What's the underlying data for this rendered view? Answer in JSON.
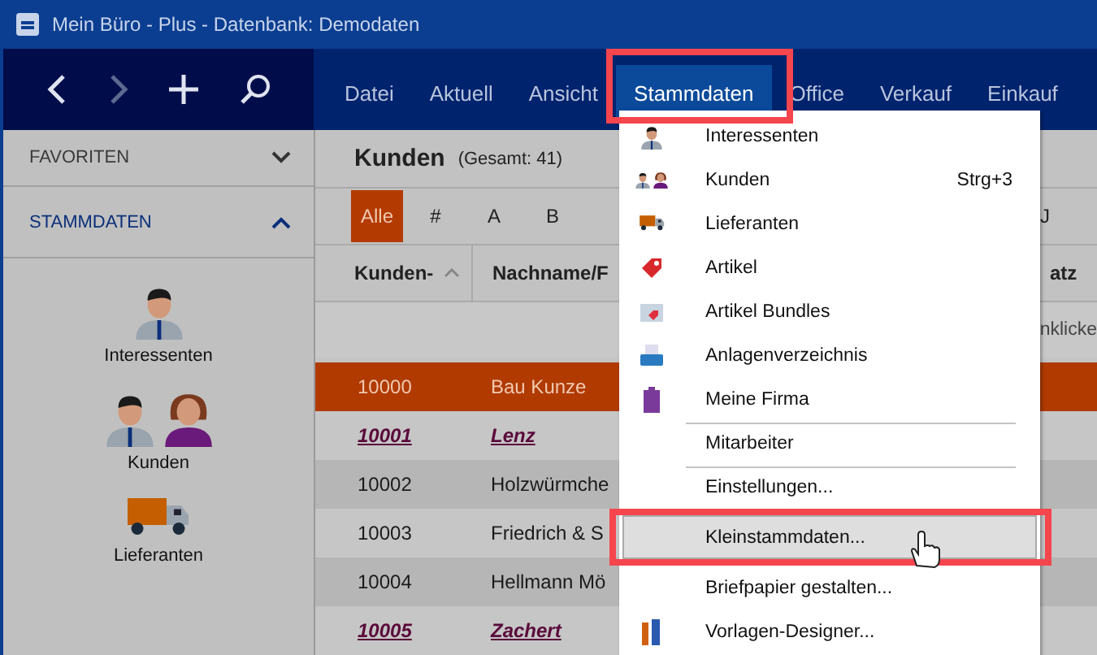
{
  "window": {
    "title": "Mein Büro - Plus - Datenbank: Demodaten"
  },
  "menubar": [
    {
      "label": "Datei",
      "selected": false
    },
    {
      "label": "Aktuell",
      "selected": false
    },
    {
      "label": "Ansicht",
      "selected": false
    },
    {
      "label": "Stammdaten",
      "selected": true
    },
    {
      "label": "Office",
      "selected": false
    },
    {
      "label": "Verkauf",
      "selected": false
    },
    {
      "label": "Einkauf",
      "selected": false
    }
  ],
  "sidebar": {
    "sections": [
      {
        "label": "FAVORITEN",
        "expanded": false
      },
      {
        "label": "STAMMDATEN",
        "expanded": true
      }
    ],
    "items": [
      {
        "label": "Interessenten"
      },
      {
        "label": "Kunden"
      },
      {
        "label": "Lieferanten"
      }
    ]
  },
  "content": {
    "title": "Kunden",
    "count": "(Gesamt: 41)",
    "letters": [
      {
        "label": "Alle",
        "selected": true
      },
      {
        "label": "#",
        "selected": false
      },
      {
        "label": "A",
        "selected": false
      },
      {
        "label": "B",
        "selected": false
      },
      {
        "label": "J",
        "selected": false
      }
    ],
    "filter_hint": "nklicke",
    "table": {
      "columns": [
        "Kunden-",
        "Nachname/F",
        "atz"
      ],
      "rows": [
        {
          "cells": [
            "10000",
            "Bau Kunze"
          ],
          "selected": true,
          "emphasized": false
        },
        {
          "cells": [
            "10001",
            "Lenz"
          ],
          "selected": false,
          "emphasized": true
        },
        {
          "cells": [
            "10002",
            "Holzwürmche"
          ],
          "selected": false,
          "emphasized": false
        },
        {
          "cells": [
            "10003",
            "Friedrich & S"
          ],
          "selected": false,
          "emphasized": false
        },
        {
          "cells": [
            "10004",
            "Hellmann Mö"
          ],
          "selected": false,
          "emphasized": false
        },
        {
          "cells": [
            "10005",
            "Zachert"
          ],
          "selected": false,
          "emphasized": true
        }
      ]
    }
  },
  "dropdown_menu": {
    "items": [
      {
        "label": "Interessenten",
        "selected": false,
        "separator_before": false
      },
      {
        "label": "Kunden",
        "shortcut": "Strg+3",
        "selected": false,
        "separator_before": false
      },
      {
        "label": "Lieferanten",
        "selected": false,
        "separator_before": false
      },
      {
        "label": "Artikel",
        "selected": false,
        "separator_before": false
      },
      {
        "label": "Artikel Bundles",
        "selected": false,
        "separator_before": false
      },
      {
        "label": "Anlagenverzeichnis",
        "selected": false,
        "separator_before": false
      },
      {
        "label": "Meine Firma",
        "selected": false,
        "separator_before": false
      },
      {
        "label": "Mitarbeiter",
        "selected": false,
        "separator_before": true
      },
      {
        "label": "Einstellungen...",
        "selected": false,
        "separator_before": true
      },
      {
        "label": "Kleinstammdaten...",
        "selected": true,
        "separator_before": false
      },
      {
        "label": "Briefpapier gestalten...",
        "selected": false,
        "separator_before": false
      },
      {
        "label": "Vorlagen-Designer...",
        "selected": false,
        "separator_before": false
      }
    ]
  }
}
